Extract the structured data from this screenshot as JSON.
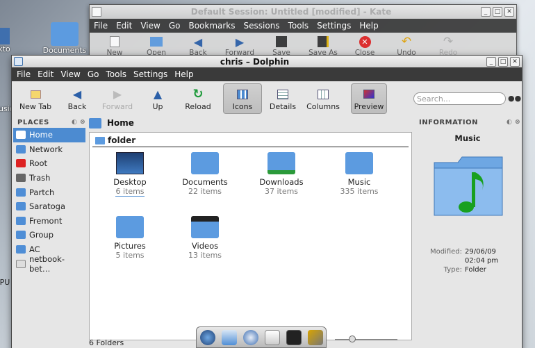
{
  "desktop": {
    "icons": [
      {
        "label": "Documents"
      },
      {
        "label": "kto"
      },
      {
        "label": "usic"
      },
      {
        "label": "PU"
      }
    ]
  },
  "kate": {
    "title": "Default Session: Untitled [modified] - Kate",
    "menu": [
      "File",
      "Edit",
      "View",
      "Go",
      "Bookmarks",
      "Sessions",
      "Tools",
      "Settings",
      "Help"
    ],
    "toolbar": [
      {
        "label": "New",
        "icon": "new-doc-icon"
      },
      {
        "label": "Open",
        "icon": "open-icon"
      },
      {
        "label": "Back",
        "icon": "back-arrow-icon"
      },
      {
        "label": "Forward",
        "icon": "forward-arrow-icon"
      },
      {
        "label": "Save",
        "icon": "save-icon"
      },
      {
        "label": "Save As",
        "icon": "save-as-icon"
      },
      {
        "label": "Close",
        "icon": "close-icon"
      },
      {
        "label": "Undo",
        "icon": "undo-icon"
      },
      {
        "label": "Redo",
        "icon": "redo-icon"
      }
    ]
  },
  "dolphin": {
    "title": "chris – Dolphin",
    "menu": [
      "File",
      "Edit",
      "View",
      "Go",
      "Tools",
      "Settings",
      "Help"
    ],
    "toolbar": {
      "new_tab": "New Tab",
      "back": "Back",
      "forward": "Forward",
      "up": "Up",
      "reload": "Reload",
      "icons": "Icons",
      "details": "Details",
      "columns": "Columns",
      "preview": "Preview"
    },
    "search_placeholder": "Search...",
    "places": {
      "title": "PLACES",
      "items": [
        {
          "label": "Home",
          "color": "#4f8ed6"
        },
        {
          "label": "Network",
          "color": "#4f8ed6"
        },
        {
          "label": "Root",
          "color": "#d22"
        },
        {
          "label": "Trash",
          "color": "#666"
        },
        {
          "label": "Partch",
          "color": "#4f8ed6"
        },
        {
          "label": "Saratoga",
          "color": "#4f8ed6"
        },
        {
          "label": "Fremont",
          "color": "#4f8ed6"
        },
        {
          "label": "Group",
          "color": "#4f8ed6"
        },
        {
          "label": "AC",
          "color": "#4f8ed6"
        },
        {
          "label": "netbook-bet…",
          "color": "#ddd"
        }
      ]
    },
    "breadcrumb": "Home",
    "group_header": "folder",
    "items": [
      {
        "name": "Desktop",
        "count": "6 items"
      },
      {
        "name": "Documents",
        "count": "22 items"
      },
      {
        "name": "Downloads",
        "count": "37 items"
      },
      {
        "name": "Music",
        "count": "335 items"
      },
      {
        "name": "Pictures",
        "count": "5 items"
      },
      {
        "name": "Videos",
        "count": "13 items"
      }
    ],
    "info": {
      "title": "INFORMATION",
      "name": "Music",
      "modified_label": "Modified:",
      "modified_date": "29/06/09",
      "modified_time": "02:04 pm",
      "type_label": "Type:",
      "type_value": "Folder"
    },
    "status": "6 Folders"
  }
}
